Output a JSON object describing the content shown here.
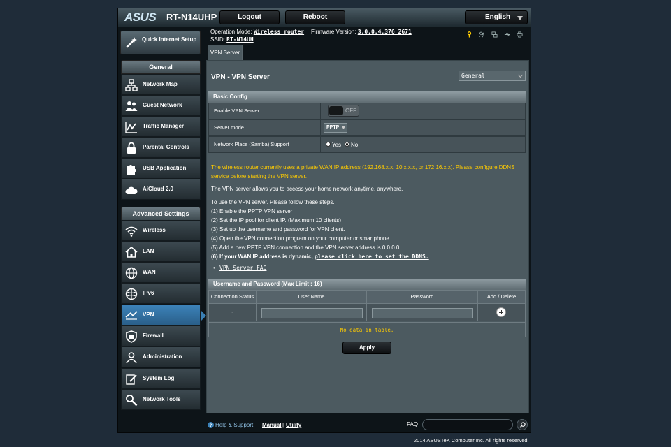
{
  "header": {
    "brand": "ASUS",
    "model": "RT-N14UHP",
    "logout_label": "Logout",
    "reboot_label": "Reboot",
    "language": "English"
  },
  "status": {
    "operation_mode_label": "Operation Mode:",
    "operation_mode_value": "Wireless router",
    "firmware_label": "Firmware Version:",
    "firmware_value": "3.0.0.4.376_2671",
    "ssid_label": "SSID:",
    "ssid_value": "RT-N14UH"
  },
  "sidebar": {
    "quick_setup": "Quick Internet Setup",
    "general_header": "General",
    "general_items": [
      {
        "label": "Network Map"
      },
      {
        "label": "Guest Network"
      },
      {
        "label": "Traffic Manager"
      },
      {
        "label": "Parental Controls"
      },
      {
        "label": "USB Application"
      },
      {
        "label": "AiCloud 2.0"
      }
    ],
    "advanced_header": "Advanced Settings",
    "advanced_items": [
      {
        "label": "Wireless"
      },
      {
        "label": "LAN"
      },
      {
        "label": "WAN"
      },
      {
        "label": "IPv6"
      },
      {
        "label": "VPN"
      },
      {
        "label": "Firewall"
      },
      {
        "label": "Administration"
      },
      {
        "label": "System Log"
      },
      {
        "label": "Network Tools"
      }
    ],
    "active_item": "VPN"
  },
  "main": {
    "tab": "VPN Server",
    "title": "VPN - VPN Server",
    "view_select": "General",
    "basic_config": {
      "header": "Basic Config",
      "enable_label": "Enable VPN Server",
      "enable_state": "OFF",
      "server_mode_label": "Server mode",
      "server_mode_value": "PPTP",
      "samba_label": "Network Place (Samba) Support",
      "samba_yes": "Yes",
      "samba_no": "No"
    },
    "warning": [
      "The wireless router currently uses a private WAN IP address (192.168.x.x, 10.x.x.x, or 172.16.x.x). Please configure DDNS",
      "service before starting the VPN server."
    ],
    "intro": "The VPN server allows you to access your home network anytime, anywhere.",
    "steps_intro": "To use the VPN server. Please follow these steps.",
    "steps": [
      "(1) Enable the PPTP VPN server",
      "(2) Set the IP pool for client IP. (Maximum 10 clients)",
      "(3) Set up the username and password for VPN client.",
      "(4) Open the VPN connection program on your computer or smartphone.",
      "(5) Add a new PPTP VPN connection and the VPN server address is 0.0.0.0"
    ],
    "step6_prefix": "(6) If your WAN IP address is dynamic,",
    "step6_link": "please click here to set the DDNS.",
    "faq_link": "VPN Server FAQ",
    "user_table": {
      "header": "Username and Password (Max Limit : 16)",
      "columns": [
        "Connection Status",
        "User Name",
        "Password",
        "Add / Delete"
      ],
      "status_placeholder": "-",
      "empty_text": "No data in table."
    },
    "apply_label": "Apply"
  },
  "footer": {
    "help": "Help & Support",
    "manual": "Manual",
    "separator": "|",
    "utility": "Utility",
    "faq": "FAQ",
    "copyright": "2014 ASUSTeK Computer Inc. All rights reserved."
  },
  "colors": {
    "accent": "#3c82b8",
    "warning": "#ffcc00",
    "panel": "#4c5a60",
    "background": "#1f2c39"
  }
}
